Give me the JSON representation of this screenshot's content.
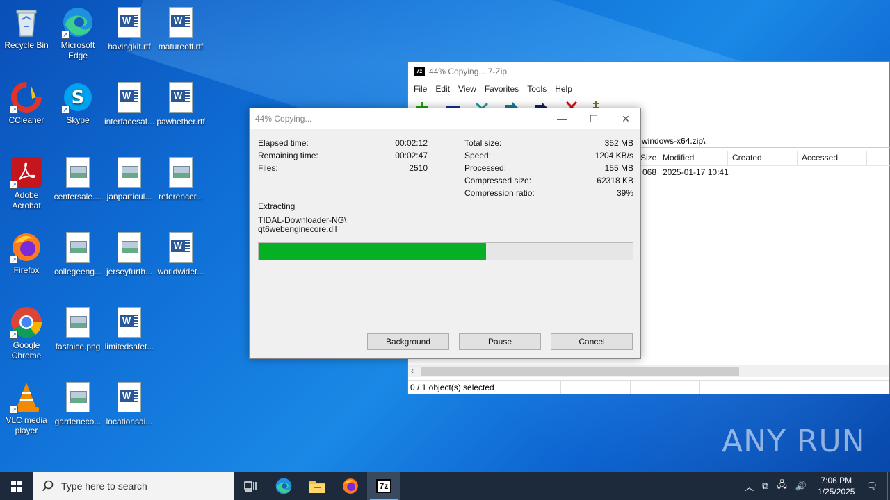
{
  "desktop": {
    "icons": [
      {
        "label": "Recycle Bin"
      },
      {
        "label": "Microsoft Edge"
      },
      {
        "label": "havingkit.rtf"
      },
      {
        "label": "matureoff.rtf"
      },
      {
        "label": "CCleaner"
      },
      {
        "label": "Skype"
      },
      {
        "label": "interfacesaf..."
      },
      {
        "label": "pawhether.rtf"
      },
      {
        "label": "Adobe Acrobat"
      },
      {
        "label": "centersale...."
      },
      {
        "label": "janparticul..."
      },
      {
        "label": "referencer..."
      },
      {
        "label": "Firefox"
      },
      {
        "label": "collegeeng..."
      },
      {
        "label": "jerseyfurth..."
      },
      {
        "label": "worldwidet..."
      },
      {
        "label": "Google Chrome"
      },
      {
        "label": "fastnice.png"
      },
      {
        "label": "limitedsafet..."
      },
      {
        "label": "VLC media player"
      },
      {
        "label": "gardeneco..."
      },
      {
        "label": "locationsai..."
      }
    ]
  },
  "zip_window": {
    "app_icon_text": "7z",
    "title": "44% Copying... 7-Zip",
    "menu": [
      "File",
      "Edit",
      "View",
      "Favorites",
      "Tools",
      "Help"
    ],
    "address": "windows-x64.zip\\",
    "columns": [
      "Size",
      "Modified",
      "Created",
      "Accessed"
    ],
    "row": {
      "size": "068",
      "modified": "2025-01-17 10:41"
    },
    "status": "0 / 1 object(s) selected"
  },
  "dialog": {
    "title": "44% Copying...",
    "left": {
      "elapsed_label": "Elapsed time:",
      "elapsed_value": "00:02:12",
      "remaining_label": "Remaining time:",
      "remaining_value": "00:02:47",
      "files_label": "Files:",
      "files_value": "2510"
    },
    "right": {
      "total_label": "Total size:",
      "total_value": "352 MB",
      "speed_label": "Speed:",
      "speed_value": "1204 KB/s",
      "processed_label": "Processed:",
      "processed_value": "155 MB",
      "compressed_label": "Compressed size:",
      "compressed_value": "62318 KB",
      "ratio_label": "Compression ratio:",
      "ratio_value": "39%"
    },
    "action": "Extracting",
    "path_line1": "TIDAL-Downloader-NG\\",
    "path_line2": "qt6webenginecore.dll",
    "progress_fraction": 0.607,
    "progress_color": "#06b025",
    "buttons": {
      "background": "Background",
      "pause": "Pause",
      "cancel": "Cancel"
    }
  },
  "taskbar": {
    "search_placeholder": "Type here to search",
    "time": "7:06 PM",
    "date": "1/25/2025",
    "app_7zip_text": "7z"
  },
  "watermark": "ANY RUN"
}
